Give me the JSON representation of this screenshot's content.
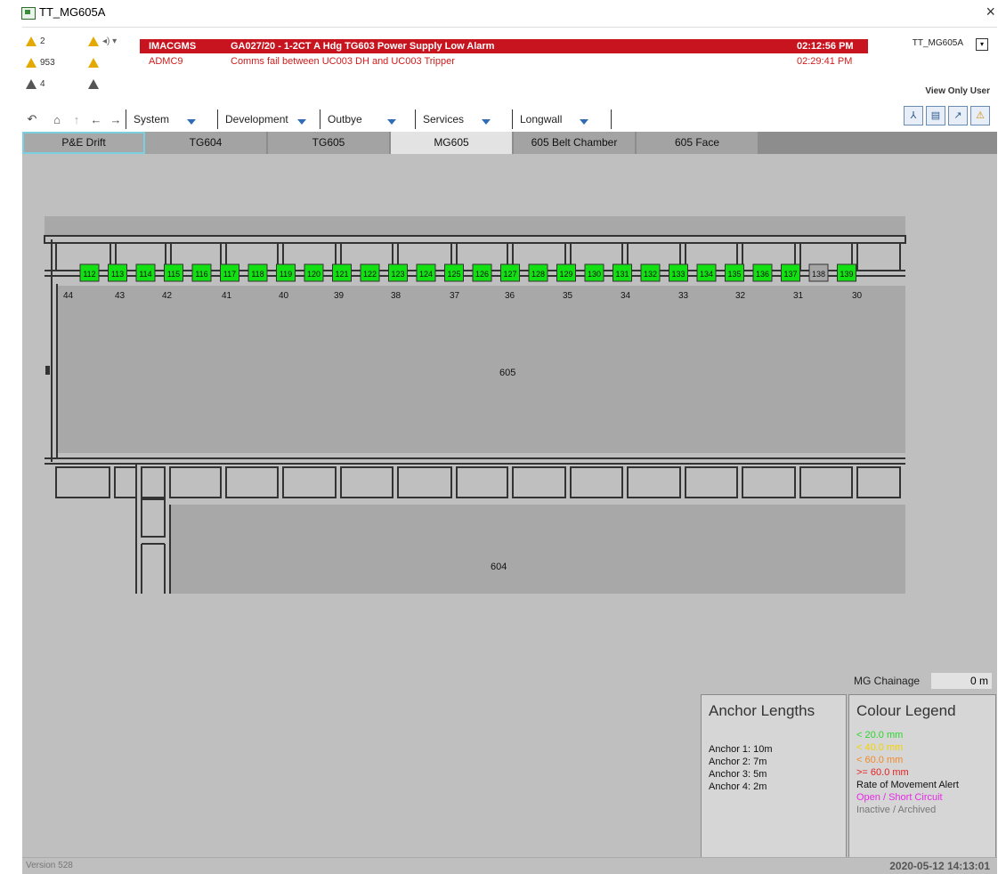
{
  "window": {
    "title": "TT_MG605A",
    "close": "×"
  },
  "alarm_counts": [
    {
      "icon": "warning-acknowledged-icon",
      "value": "2"
    },
    {
      "icon": "warning-sound-icon",
      "value": ""
    },
    {
      "icon": "warning-icon",
      "value": "953"
    },
    {
      "icon": "warning-comment-icon",
      "value": ""
    },
    {
      "icon": "alarm-cleared-icon",
      "value": "4"
    },
    {
      "icon": "alarm-list-icon",
      "value": ""
    }
  ],
  "alarms": [
    {
      "source": "IMACGMS",
      "message": "GA027/20 - 1-2CT A Hdg TG603 Power Supply Low Alarm",
      "time": "02:12:56 PM"
    },
    {
      "source": "ADMC9",
      "message": "Comms fail between UC003 DH and UC003 Tripper",
      "time": "02:29:41 PM"
    }
  ],
  "user": {
    "station": "TT_MG605A",
    "role": "View Only User"
  },
  "nav": {
    "menus": [
      "System",
      "Development",
      "Outbye",
      "Services",
      "Longwall"
    ]
  },
  "tabs": [
    "P&E Drift",
    "TG604",
    "TG605",
    "MG605",
    "605 Belt Chamber",
    "605 Face"
  ],
  "active_tab": "MG605",
  "map": {
    "sensors": [
      "112",
      "113",
      "114",
      "115",
      "116",
      "117",
      "118",
      "119",
      "120",
      "121",
      "122",
      "123",
      "124",
      "125",
      "126",
      "127",
      "128",
      "129",
      "130",
      "131",
      "132",
      "133",
      "134",
      "135",
      "136",
      "137",
      "138",
      "139"
    ],
    "inactive_sensor": "138",
    "cut_through_labels": [
      "44",
      "43",
      "42",
      "41",
      "40",
      "39",
      "38",
      "37",
      "36",
      "35",
      "34",
      "33",
      "32",
      "31",
      "30"
    ],
    "panel_labels": [
      "605",
      "604"
    ],
    "colors": {
      "sensor_ok": "#13e013",
      "sensor_inactive": "#a6a6a6"
    }
  },
  "chainage": {
    "label": "MG Chainage",
    "value": "0 m"
  },
  "anchor_lengths": {
    "title": "Anchor Lengths",
    "items": [
      "Anchor 1: 10m",
      "Anchor 2: 7m",
      "Anchor 3: 5m",
      "Anchor 4: 2m"
    ]
  },
  "colour_legend": {
    "title": "Colour Legend",
    "items": [
      {
        "text": "<  20.0 mm",
        "color": "#2cd62c"
      },
      {
        "text": "<  40.0 mm",
        "color": "#f2d400"
      },
      {
        "text": "<  60.0 mm",
        "color": "#f08a2c"
      },
      {
        "text": ">= 60.0 mm",
        "color": "#e52121"
      },
      {
        "text": "Rate of Movement Alert",
        "color": "#111111"
      },
      {
        "text": "Open / Short Circuit",
        "color": "#e62ae6"
      },
      {
        "text": "Inactive / Archived",
        "color": "#777777"
      }
    ]
  },
  "status": {
    "version": "Version 528",
    "datetime": "2020-05-12 14:13:01"
  }
}
